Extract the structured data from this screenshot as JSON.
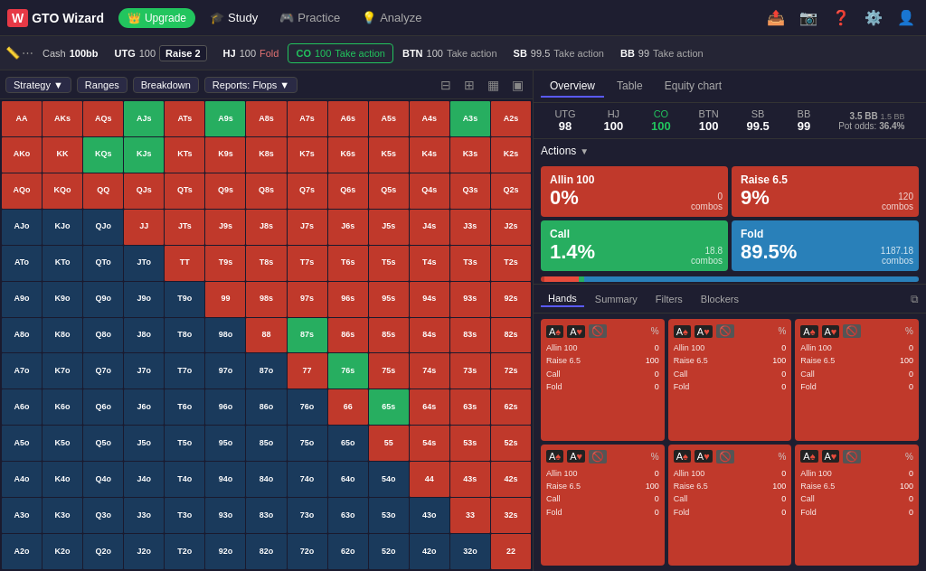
{
  "header": {
    "logo": "W",
    "app_name": "GTO Wizard",
    "upgrade_label": "Upgrade",
    "nav": [
      {
        "id": "study",
        "label": "Study",
        "icon": "🎓",
        "active": true
      },
      {
        "id": "practice",
        "label": "Practice",
        "icon": "🎮"
      },
      {
        "id": "analyze",
        "label": "Analyze",
        "icon": "💡"
      }
    ],
    "right_icons": [
      "📤",
      "📷",
      "❓",
      "⚙️",
      "👤"
    ]
  },
  "tabbar": {
    "items": [
      {
        "id": "ruler",
        "label": ""
      },
      {
        "id": "dots",
        "label": ""
      },
      {
        "position": "Cash",
        "stack": "100bb",
        "sep": true
      },
      {
        "position": "UTG",
        "stack": "100",
        "action": "Raise 2",
        "badge": "raise"
      },
      {
        "position": "HJ",
        "stack": "100",
        "action": "Fold"
      },
      {
        "position": "CO",
        "stack": "100",
        "action": "Take action",
        "active": true
      },
      {
        "position": "BTN",
        "stack": "100",
        "action": "Take action"
      },
      {
        "position": "SB",
        "stack": "99.5",
        "action": "Take action"
      },
      {
        "position": "BB",
        "stack": "99",
        "action": "Take action"
      }
    ]
  },
  "toolbar": {
    "strategy_label": "Strategy",
    "ranges_label": "Ranges",
    "breakdown_label": "Breakdown",
    "reports_label": "Reports: Flops"
  },
  "right_panel": {
    "tabs": [
      "Overview",
      "Table",
      "Equity chart"
    ],
    "active_tab": "Overview",
    "positions": [
      {
        "name": "UTG",
        "stack": "98"
      },
      {
        "name": "HJ",
        "stack": "100"
      },
      {
        "name": "CO",
        "stack": "100",
        "active": true
      },
      {
        "name": "BTN",
        "stack": "100"
      },
      {
        "name": "SB",
        "stack": "99.5"
      },
      {
        "name": "BB",
        "stack": "99"
      }
    ],
    "pot_odds_label": "Pot odds:",
    "pot_odds_value": "36.4%",
    "pot_size_label": "3.5 BB",
    "pot_size_sub": "1.5 BB",
    "actions_label": "Actions",
    "action_cards": [
      {
        "id": "allin",
        "name": "Allin 100",
        "pct": "0%",
        "combos": "0",
        "combos_label": "combos"
      },
      {
        "id": "raise",
        "name": "Raise 6.5",
        "pct": "9%",
        "combos": "120",
        "combos_label": "combos"
      },
      {
        "id": "call",
        "name": "Call",
        "pct": "1.4%",
        "combos": "18.8",
        "combos_label": "combos"
      },
      {
        "id": "fold",
        "name": "Fold",
        "pct": "89.5%",
        "combos": "1187.18",
        "combos_label": "combos"
      }
    ]
  },
  "bottom_panel": {
    "tabs": [
      "Hands",
      "Summary",
      "Filters",
      "Blockers"
    ],
    "active_tab": "Hands",
    "hand_cards": [
      {
        "suits": [
          "♠",
          "♠",
          "♥"
        ],
        "card": "A♠A♥",
        "pct": "%",
        "actions": [
          {
            "name": "Allin 100",
            "val": "0"
          },
          {
            "name": "Raise 6.5",
            "val": "100"
          },
          {
            "name": "Call",
            "val": "0"
          },
          {
            "name": "Fold",
            "val": "0"
          }
        ]
      },
      {
        "suits": [
          "♠",
          "♠",
          "♦"
        ],
        "card": "A♠A♦",
        "pct": "%",
        "actions": [
          {
            "name": "Allin 100",
            "val": "0"
          },
          {
            "name": "Raise 6.5",
            "val": "100"
          },
          {
            "name": "Call",
            "val": "0"
          },
          {
            "name": "Fold",
            "val": "0"
          }
        ]
      },
      {
        "suits": [
          "♥",
          "♠",
          "♦"
        ],
        "card": "A♥A♦",
        "pct": "%",
        "actions": [
          {
            "name": "Allin 100",
            "val": "0"
          },
          {
            "name": "Raise 6.5",
            "val": "100"
          },
          {
            "name": "Call",
            "val": "0"
          },
          {
            "name": "Fold",
            "val": "0"
          }
        ]
      },
      {
        "suits": [
          "♠",
          "♠",
          "♣"
        ],
        "card": "A♠A♣",
        "pct": "%",
        "actions": [
          {
            "name": "Allin 100",
            "val": "0"
          },
          {
            "name": "Raise 6.5",
            "val": "100"
          },
          {
            "name": "Call",
            "val": "0"
          },
          {
            "name": "Fold",
            "val": "0"
          }
        ]
      },
      {
        "suits": [
          "♥",
          "♠",
          "♣"
        ],
        "card": "A♥A♣",
        "pct": "%",
        "actions": [
          {
            "name": "Allin 100",
            "val": "0"
          },
          {
            "name": "Raise 6.5",
            "val": "100"
          },
          {
            "name": "Call",
            "val": "0"
          },
          {
            "name": "Fold",
            "val": "0"
          }
        ]
      },
      {
        "suits": [
          "♦",
          "♠",
          "♣"
        ],
        "card": "A♦A♣",
        "pct": "%",
        "actions": [
          {
            "name": "Allin 100",
            "val": "0"
          },
          {
            "name": "Raise 6.5",
            "val": "100"
          },
          {
            "name": "Call",
            "val": "0"
          },
          {
            "name": "Fold",
            "val": "0"
          }
        ]
      }
    ]
  },
  "hand_matrix": {
    "rows": [
      [
        "AA",
        "AKs",
        "AQs",
        "AJs",
        "ATs",
        "A9s",
        "A8s",
        "A7s",
        "A6s",
        "A5s",
        "A4s",
        "A3s",
        "A2s"
      ],
      [
        "AKo",
        "KK",
        "KQs",
        "KJs",
        "KTs",
        "K9s",
        "K8s",
        "K7s",
        "K6s",
        "K5s",
        "K4s",
        "K3s",
        "K2s"
      ],
      [
        "AQo",
        "KQo",
        "QQ",
        "QJs",
        "QTs",
        "Q9s",
        "Q8s",
        "Q7s",
        "Q6s",
        "Q5s",
        "Q4s",
        "Q3s",
        "Q2s"
      ],
      [
        "AJo",
        "KJo",
        "QJo",
        "JJ",
        "JTs",
        "J9s",
        "J8s",
        "J7s",
        "J6s",
        "J5s",
        "J4s",
        "J3s",
        "J2s"
      ],
      [
        "ATo",
        "KTo",
        "QTo",
        "JTo",
        "TT",
        "T9s",
        "T8s",
        "T7s",
        "T6s",
        "T5s",
        "T4s",
        "T3s",
        "T2s"
      ],
      [
        "A9o",
        "K9o",
        "Q9o",
        "J9o",
        "T9o",
        "99",
        "98s",
        "97s",
        "96s",
        "95s",
        "94s",
        "93s",
        "92s"
      ],
      [
        "A8o",
        "K8o",
        "Q8o",
        "J8o",
        "T8o",
        "98o",
        "88",
        "87s",
        "86s",
        "85s",
        "84s",
        "83s",
        "82s"
      ],
      [
        "A7o",
        "K7o",
        "Q7o",
        "J7o",
        "T7o",
        "97o",
        "87o",
        "77",
        "76s",
        "75s",
        "74s",
        "73s",
        "72s"
      ],
      [
        "A6o",
        "K6o",
        "Q6o",
        "J6o",
        "T6o",
        "96o",
        "86o",
        "76o",
        "66",
        "65s",
        "64s",
        "63s",
        "62s"
      ],
      [
        "A5o",
        "K5o",
        "Q5o",
        "J5o",
        "T5o",
        "95o",
        "85o",
        "75o",
        "65o",
        "55",
        "54s",
        "53s",
        "52s"
      ],
      [
        "A4o",
        "K4o",
        "Q4o",
        "J4o",
        "T4o",
        "94o",
        "84o",
        "74o",
        "64o",
        "54o",
        "44",
        "43s",
        "42s"
      ],
      [
        "A3o",
        "K3o",
        "Q3o",
        "J3o",
        "T3o",
        "93o",
        "83o",
        "73o",
        "63o",
        "53o",
        "43o",
        "33",
        "32s"
      ],
      [
        "A2o",
        "K2o",
        "Q2o",
        "J2o",
        "T2o",
        "92o",
        "82o",
        "72o",
        "62o",
        "52o",
        "42o",
        "32o",
        "22"
      ]
    ],
    "colors": [
      [
        "red",
        "red",
        "red",
        "green",
        "red",
        "green",
        "red",
        "red",
        "red",
        "red",
        "red",
        "green",
        "red"
      ],
      [
        "red",
        "red",
        "red",
        "green",
        "red",
        "red",
        "red",
        "red",
        "red",
        "red",
        "red",
        "red",
        "red"
      ],
      [
        "red",
        "red",
        "red",
        "red",
        "red",
        "red",
        "red",
        "red",
        "red",
        "red",
        "red",
        "red",
        "red"
      ],
      [
        "blue",
        "blue",
        "blue",
        "red",
        "red",
        "red",
        "red",
        "red",
        "red",
        "red",
        "red",
        "red",
        "red"
      ],
      [
        "blue",
        "blue",
        "blue",
        "blue",
        "red",
        "red",
        "red",
        "red",
        "red",
        "red",
        "red",
        "red",
        "red"
      ],
      [
        "blue",
        "blue",
        "blue",
        "blue",
        "blue",
        "green",
        "red",
        "red",
        "red",
        "red",
        "red",
        "red",
        "red"
      ],
      [
        "blue",
        "blue",
        "blue",
        "blue",
        "blue",
        "blue",
        "red",
        "green",
        "red",
        "red",
        "red",
        "red",
        "red"
      ],
      [
        "blue",
        "blue",
        "blue",
        "blue",
        "blue",
        "blue",
        "blue",
        "red",
        "green",
        "red",
        "red",
        "red",
        "red"
      ],
      [
        "blue",
        "blue",
        "blue",
        "blue",
        "blue",
        "blue",
        "blue",
        "blue",
        "green",
        "green",
        "red",
        "red",
        "red"
      ],
      [
        "blue",
        "blue",
        "blue",
        "blue",
        "blue",
        "blue",
        "blue",
        "blue",
        "blue",
        "red",
        "red",
        "red",
        "red"
      ],
      [
        "blue",
        "blue",
        "blue",
        "blue",
        "blue",
        "blue",
        "blue",
        "blue",
        "blue",
        "blue",
        "red",
        "red",
        "red"
      ],
      [
        "blue",
        "blue",
        "blue",
        "blue",
        "blue",
        "blue",
        "blue",
        "blue",
        "blue",
        "blue",
        "blue",
        "red",
        "red"
      ],
      [
        "blue",
        "blue",
        "blue",
        "blue",
        "blue",
        "blue",
        "blue",
        "blue",
        "blue",
        "blue",
        "blue",
        "blue",
        "red"
      ]
    ]
  }
}
